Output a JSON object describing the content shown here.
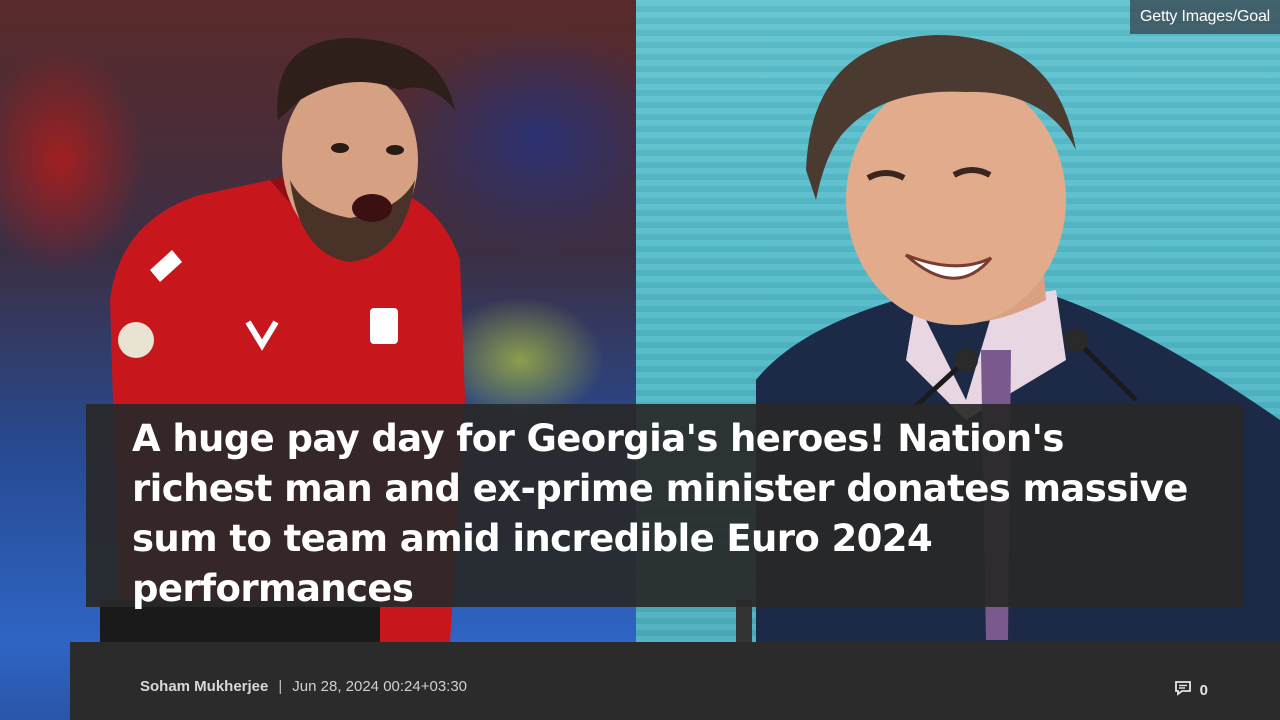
{
  "image": {
    "left_alt": "footballer-in-red-kit",
    "right_alt": "man-at-podium-smiling",
    "credit": "Getty Images/Goal"
  },
  "headline": "A huge pay day for Georgia's heroes! Nation's richest man and ex-prime minister donates massive sum to team amid incredible Euro 2024 performances",
  "meta": {
    "author": "Soham Mukherjee",
    "separator": "|",
    "date": "Jun 28, 2024 00:24+03:30"
  },
  "comments": {
    "icon": "comment-icon",
    "count": "0"
  },
  "colors": {
    "headline_bg": "#282828",
    "meta_bg": "#2b2b2b",
    "sky_teal": "#4fb7c6",
    "kit_red": "#c8161d"
  }
}
